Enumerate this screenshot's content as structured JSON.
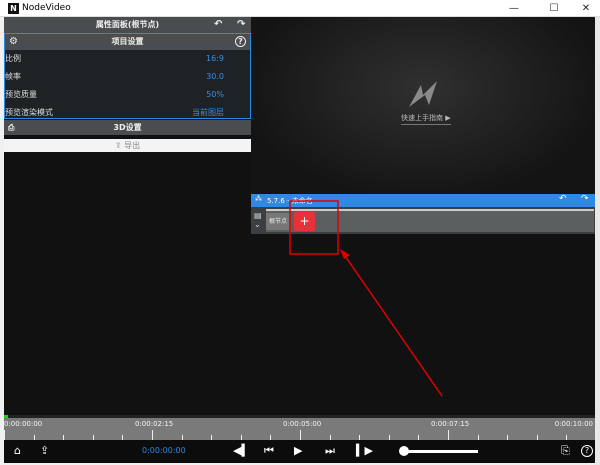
{
  "window": {
    "title": "NodeVideo",
    "minimize": "—",
    "maximize": "☐",
    "close": "✕"
  },
  "properties": {
    "title": "属性面板(根节点)",
    "undo": "↶",
    "redo": "↷",
    "project_group": "项目设置",
    "rows": [
      {
        "label": "比例",
        "value": "16:9"
      },
      {
        "label": "帧率",
        "value": "30.0"
      },
      {
        "label": "预览质量",
        "value": "50%"
      },
      {
        "label": "预览渲染模式",
        "value": "当前图层"
      }
    ],
    "three_d": "3D设置",
    "export": "导出"
  },
  "preview": {
    "guide_link": "快速上手指南 ▶"
  },
  "node_panel": {
    "version": "5.7.6 - 未命名",
    "root_node": "根节点",
    "add": "+"
  },
  "timeline": {
    "ticks": [
      "0:00:00:00",
      "0:00:02:15",
      "0:00:05:00",
      "0:00:07:15",
      "0:00:10:00"
    ]
  },
  "controls": {
    "timecode": "0:00:00:00",
    "volume": 0.0
  },
  "colors": {
    "accent": "#2f88e2",
    "value_text": "#3a8ee6",
    "add_button": "#e8323a",
    "annotation": "#e00000"
  }
}
